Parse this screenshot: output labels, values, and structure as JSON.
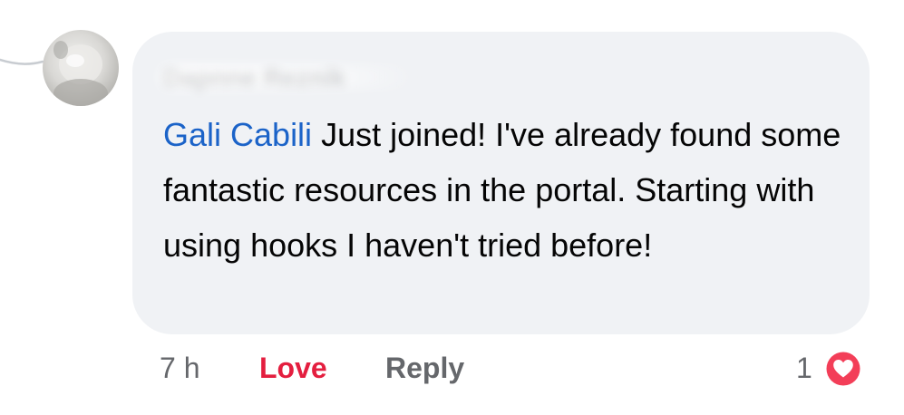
{
  "comment": {
    "author_name": "Dapnne Reznik",
    "mention": "Gali Cabili",
    "text": " Just joined! I've already found some fantastic resources in the portal. Starting with using hooks I haven't tried before!",
    "timestamp": "7 h",
    "love_label": "Love",
    "reply_label": "Reply",
    "reaction_count": "1",
    "reaction_type": "heart-icon"
  },
  "colors": {
    "bubble_bg": "#f0f2f5",
    "mention": "#1b63c8",
    "love": "#e41e3f",
    "secondary_text": "#65676b"
  }
}
